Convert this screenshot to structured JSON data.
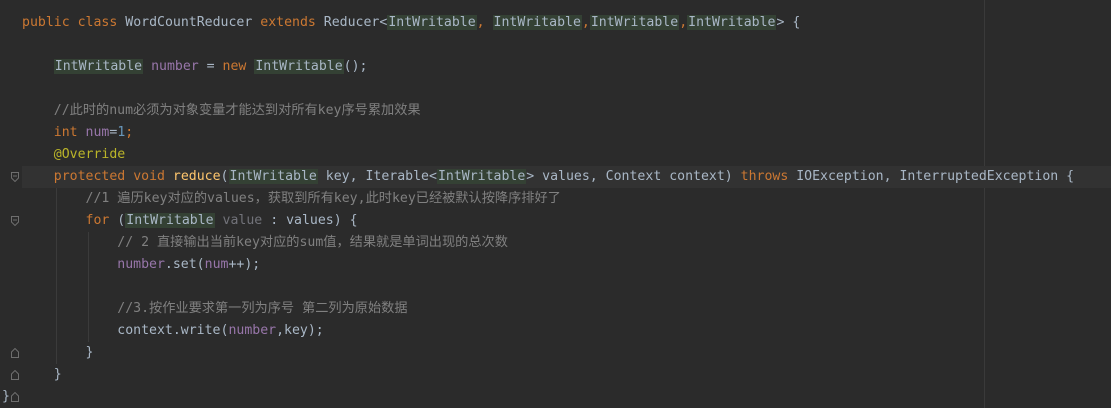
{
  "colors": {
    "background": "#2b2b2b",
    "keyword": "#cc7832",
    "field": "#9876aa",
    "number": "#6897bb",
    "method": "#ffc66d",
    "annotation": "#bbb529",
    "comment": "#808080",
    "text": "#a9b7c6",
    "type_highlight_bg": "#344134"
  },
  "icons": [
    "fold-open-icon",
    "fold-close-icon",
    "lightbulb-icon"
  ],
  "code": {
    "l1": {
      "kw1": "public",
      "kw2": "class",
      "name": "WordCountReducer",
      "kw3": "extends",
      "base": "Reducer<",
      "t1": "IntWritable",
      "s1": ", ",
      "t2": "IntWritable",
      "s2": ",",
      "t3": "IntWritable",
      "s3": ",",
      "t4": "IntWritable",
      "end": "> {"
    },
    "l3": {
      "type": "IntWritable",
      "field": "number",
      "eq": " = ",
      "kw": "new",
      "ctor": "IntWritable",
      "end": "();"
    },
    "l5": {
      "comment": "//此时的num必须为对象变量才能达到对所有key序号累加效果"
    },
    "l6": {
      "kw": "int",
      "field": "num",
      "eq": "=",
      "val": "1",
      "end": ";"
    },
    "l7": {
      "annotation": "@Override"
    },
    "l8": {
      "kw1": "protected",
      "kw2": "void",
      "method": "reduce",
      "p1": "(",
      "t1": "IntWritable",
      "p2": " key, Iterable<",
      "t2": "IntWritable",
      "p3": "> values, Context context) ",
      "kw3": "throws",
      "p4": " IOException, InterruptedException {"
    },
    "l9": {
      "comment": "//1 遍历key对应的values，获取到所有key,此时key已经被默认按降序排好了"
    },
    "l10": {
      "kw": "for",
      "p1": " (",
      "t1": "IntWritable",
      "var": "value",
      "p2": " : values) {"
    },
    "l11": {
      "comment": "// 2 直接输出当前key对应的sum值，结果就是单词出现的总次数"
    },
    "l12": {
      "field": "number",
      "call": ".set(",
      "arg": "num",
      "end": "++);"
    },
    "l14": {
      "comment": "//3.按作业要求第一列为序号 第二列为原始数据"
    },
    "l15": {
      "obj": "context",
      "call": ".write(",
      "arg": "number",
      "end": ",key);"
    },
    "l16": {
      "brace": "}"
    },
    "l17": {
      "brace": "}"
    },
    "l18": {
      "brace": "}"
    }
  }
}
